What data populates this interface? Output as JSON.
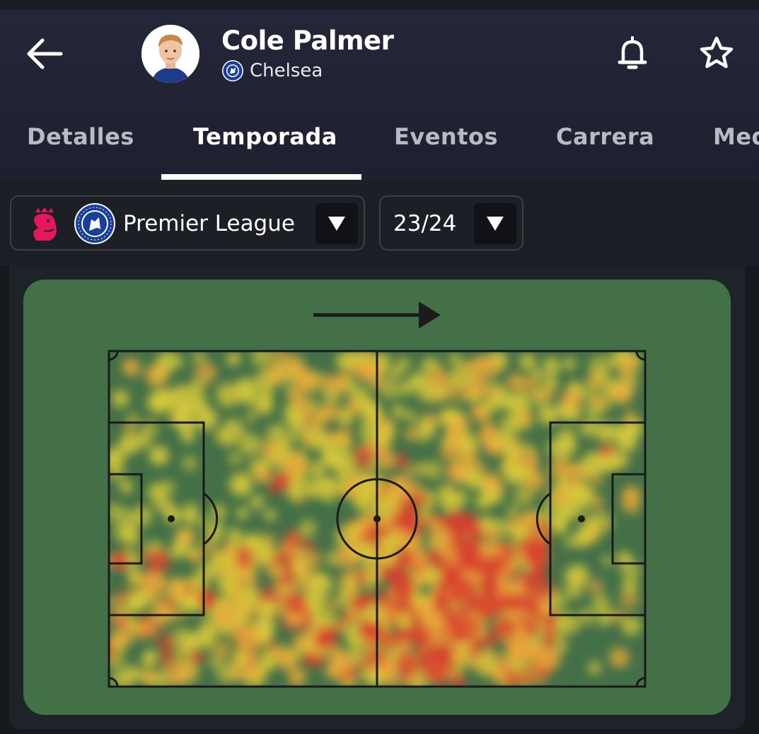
{
  "header": {
    "player_name": "Cole Palmer",
    "team_name": "Chelsea",
    "icons": {
      "back": "arrow-left-icon",
      "notifications": "bell-icon",
      "favorite": "star-icon"
    }
  },
  "tabs": [
    {
      "label": "Detalles",
      "active": false
    },
    {
      "label": "Temporada",
      "active": true
    },
    {
      "label": "Eventos",
      "active": false
    },
    {
      "label": "Carrera",
      "active": false
    },
    {
      "label": "Med",
      "active": false
    }
  ],
  "filters": {
    "competition": "Premier League",
    "season": "23/24"
  },
  "heatmap": {
    "attack_direction": "right",
    "colors": {
      "pitch": "#447048",
      "low": "#d7c93b",
      "mid": "#e8a83a",
      "high": "#d9402f",
      "lines": "#1a1a1a"
    }
  },
  "colors": {
    "header_bg": "#25273a",
    "accent": "#ffffff",
    "filter_bg": "#1c1f25"
  }
}
